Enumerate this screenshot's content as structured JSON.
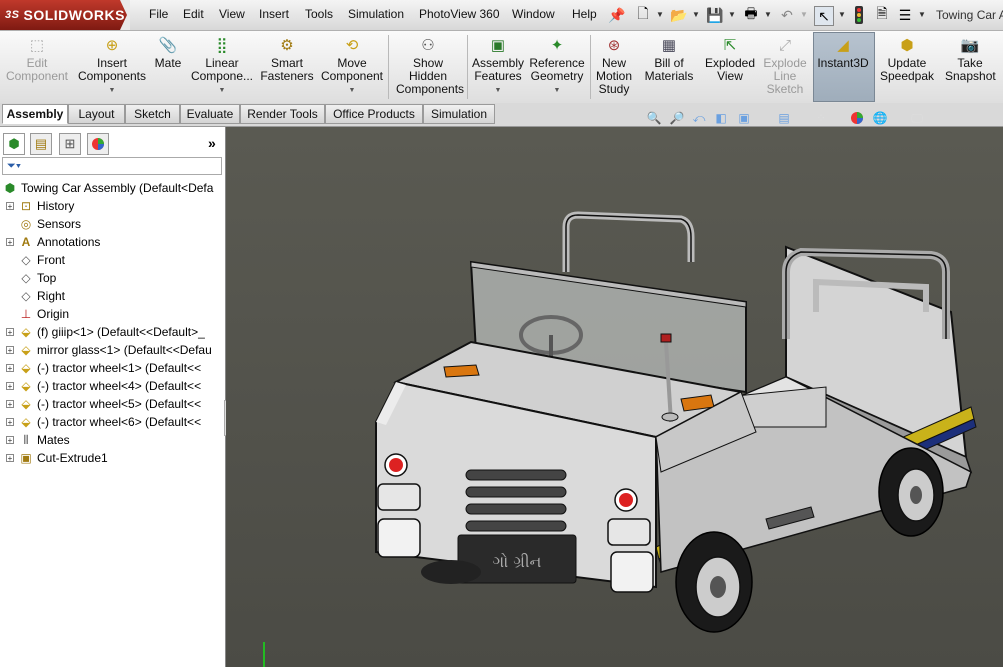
{
  "app": {
    "logo_prefix": "3S",
    "logo": "SOLIDWORKS"
  },
  "menu": [
    "File",
    "Edit",
    "View",
    "Insert",
    "Tools",
    "Simulation",
    "PhotoView 360",
    "Window",
    "Help"
  ],
  "document_title": "Towing Car Assembly",
  "quick_access_icons": [
    "pin-icon",
    "new-document-icon",
    "open-icon",
    "save-icon",
    "print-icon",
    "undo-icon",
    "select-icon",
    "rebuild-icon",
    "file-properties-icon",
    "options-icon"
  ],
  "command_manager": [
    {
      "id": "edit-component",
      "label": "Edit Component",
      "icon": "edit-component-icon",
      "enabled": false
    },
    {
      "id": "insert-components",
      "label": "Insert Components",
      "icon": "insert-components-icon",
      "enabled": true
    },
    {
      "id": "mate",
      "label": "Mate",
      "icon": "mate-icon",
      "enabled": true
    },
    {
      "id": "linear-component",
      "label": "Linear Compone...",
      "icon": "linear-pattern-icon",
      "enabled": true
    },
    {
      "id": "smart-fasteners",
      "label": "Smart Fasteners",
      "icon": "smart-fasteners-icon",
      "enabled": true
    },
    {
      "id": "move-component",
      "label": "Move Component",
      "icon": "move-component-icon",
      "enabled": true
    },
    {
      "id": "show-hidden",
      "label": "Show Hidden Components",
      "icon": "show-hidden-icon",
      "enabled": true
    },
    {
      "id": "assembly-features",
      "label": "Assembly Features",
      "icon": "assembly-features-icon",
      "enabled": true
    },
    {
      "id": "reference-geometry",
      "label": "Reference Geometry",
      "icon": "reference-geometry-icon",
      "enabled": true
    },
    {
      "id": "new-motion-study",
      "label": "New Motion Study",
      "icon": "motion-study-icon",
      "enabled": true
    },
    {
      "id": "bill-of-materials",
      "label": "Bill of Materials",
      "icon": "bom-icon",
      "enabled": true
    },
    {
      "id": "exploded-view",
      "label": "Exploded View",
      "icon": "exploded-view-icon",
      "enabled": true
    },
    {
      "id": "explode-line-sketch",
      "label": "Explode Line Sketch",
      "icon": "explode-line-icon",
      "enabled": false
    },
    {
      "id": "instant3d",
      "label": "Instant3D",
      "icon": "instant3d-icon",
      "enabled": true,
      "active": true
    },
    {
      "id": "update-speedpak",
      "label": "Update Speedpak",
      "icon": "speedpak-icon",
      "enabled": true
    },
    {
      "id": "take-snapshot",
      "label": "Take Snapshot",
      "icon": "snapshot-icon",
      "enabled": true
    }
  ],
  "tabs": [
    "Assembly",
    "Layout",
    "Sketch",
    "Evaluate",
    "Render Tools",
    "Office Products",
    "Simulation"
  ],
  "active_tab": "Assembly",
  "feature_manager": {
    "panel_tabs": [
      "feature-tree-icon",
      "property-manager-icon",
      "configuration-manager-icon",
      "display-manager-icon"
    ],
    "filter_icon": "filter-icon",
    "root": "Towing Car Assembly  (Default<Defa",
    "items": [
      {
        "label": "History",
        "icon": "history-icon",
        "expandable": true
      },
      {
        "label": "Sensors",
        "icon": "sensors-icon",
        "expandable": false
      },
      {
        "label": "Annotations",
        "icon": "annotations-icon",
        "expandable": true
      },
      {
        "label": "Front",
        "icon": "plane-icon",
        "expandable": false
      },
      {
        "label": "Top",
        "icon": "plane-icon",
        "expandable": false
      },
      {
        "label": "Right",
        "icon": "plane-icon",
        "expandable": false
      },
      {
        "label": "Origin",
        "icon": "origin-icon",
        "expandable": false
      },
      {
        "label": "(f) giiip<1> (Default<<Default>_",
        "icon": "part-icon",
        "expandable": true
      },
      {
        "label": "mirror glass<1> (Default<<Defau",
        "icon": "part-icon",
        "expandable": true
      },
      {
        "label": "(-) tractor wheel<1> (Default<<",
        "icon": "part-icon",
        "expandable": true
      },
      {
        "label": "(-) tractor wheel<4> (Default<<",
        "icon": "part-icon",
        "expandable": true
      },
      {
        "label": "(-) tractor wheel<5> (Default<<",
        "icon": "part-icon",
        "expandable": true
      },
      {
        "label": "(-) tractor wheel<6> (Default<<",
        "icon": "part-icon",
        "expandable": true
      },
      {
        "label": "Mates",
        "icon": "mates-icon",
        "expandable": true
      },
      {
        "label": "Cut-Extrude1",
        "icon": "cut-extrude-icon",
        "expandable": true
      }
    ]
  },
  "model": {
    "plate_text": "ગો ગ્રીન"
  },
  "heads_up_toolbar": [
    "zoom-to-fit-icon",
    "zoom-area-icon",
    "previous-view-icon",
    "section-view-icon",
    "view-orientation-icon",
    "display-style-icon",
    "hide-show-icon",
    "appearance-icon",
    "scene-icon",
    "view-settings-icon"
  ],
  "colors": {
    "accent_red": "#c0392b",
    "viewport_bg": "#50504a",
    "stripe_blue": "#1c2f7a",
    "stripe_yellow": "#c9b21a"
  }
}
